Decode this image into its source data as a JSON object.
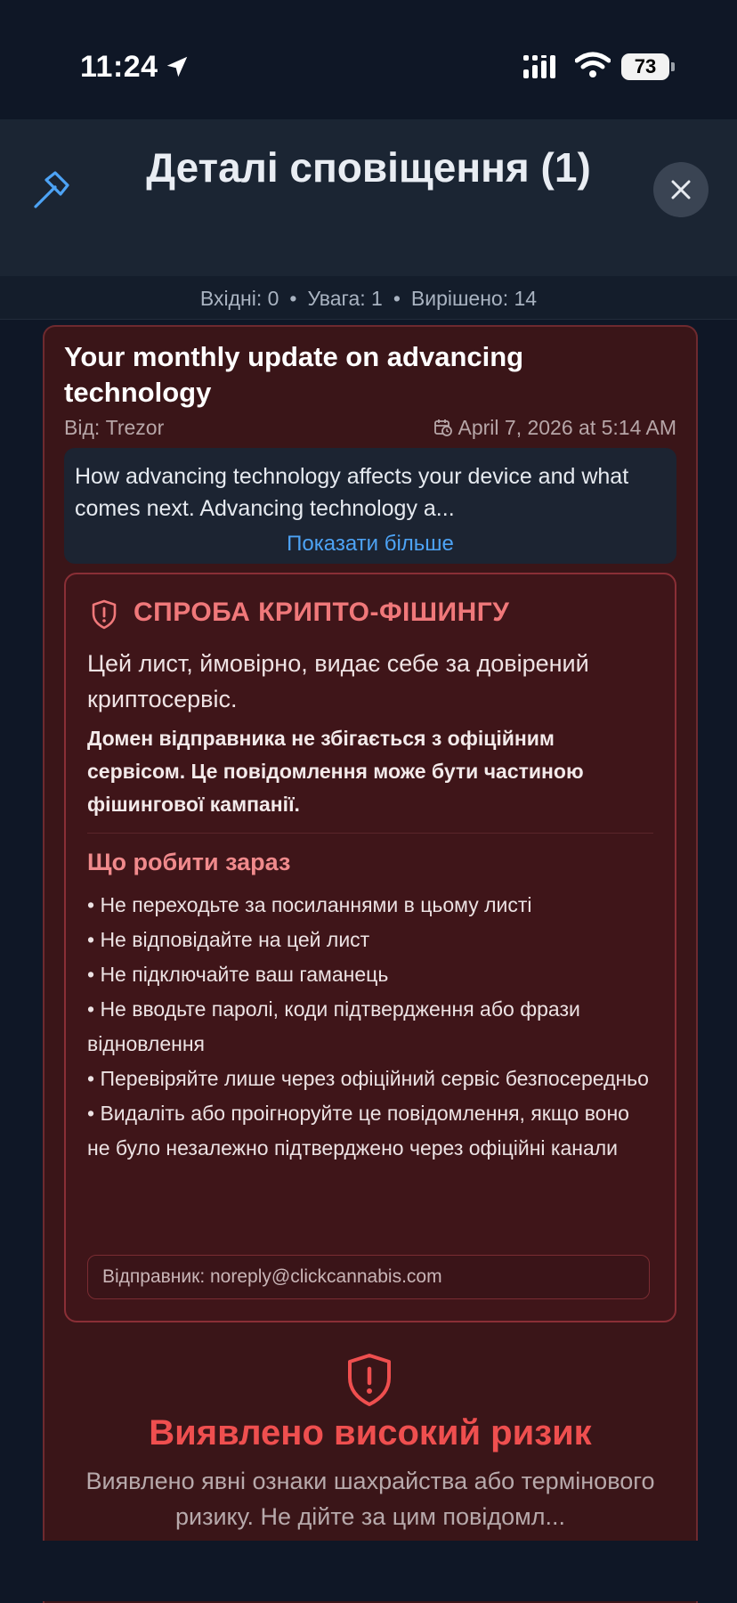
{
  "status_bar": {
    "time": "11:24",
    "battery": "73"
  },
  "header": {
    "title": "Деталі сповіщення (1)"
  },
  "stats": {
    "inbox": "Вхідні: 0",
    "attention": "Увага: 1",
    "resolved": "Вирішено: 14"
  },
  "email": {
    "title": "Your monthly update on advancing technology",
    "from": "Від: Trezor",
    "date": "April 7, 2026 at 5:14 AM",
    "preview": "How advancing technology affects your device and what comes next.  Advancing technology a...",
    "show_more": "Показати більше"
  },
  "alert": {
    "title": "СПРОБА КРИПТО-ФІШИНГУ",
    "lead": "Цей лист, ймовірно, видає себе за довірений криптосервіс.",
    "description": "Домен відправника не збігається з офіційним сервісом. Це повідомлення може бути частиною фішингової кампанії.",
    "todo_title": "Що робити зараз",
    "todo": [
      "• Не переходьте за посиланнями в цьому листі",
      "• Не відповідайте на цей лист",
      "• Не підключайте ваш гаманець",
      "• Не вводьте паролі, коди підтвердження або фрази відновлення",
      "• Перевіряйте лише через офіційний сервіс безпосередньо",
      "• Видаліть або проігноруйте це повідомлення, якщо воно не було незалежно підтверджено через офіційні канали"
    ],
    "sender": "Відправник: noreply@clickcannabis.com"
  },
  "risk": {
    "title": "Виявлено високий ризик",
    "description": "Виявлено явні ознаки шахрайства або термінового ризику. Не дійте за цим повідомл..."
  },
  "icons": {
    "location": "location-arrow-icon",
    "signal": "cellular-signal-icon",
    "wifi": "wifi-icon",
    "hammer": "hammer-icon",
    "close": "close-icon",
    "calendar": "calendar-clock-icon",
    "shield": "shield-alert-icon"
  },
  "colors": {
    "background": "#0f1726",
    "header": "#1b2533",
    "card": "#3a1518",
    "alert_red": "#f0787a",
    "risk_red": "#ef4f4f",
    "link_blue": "#4da3f5"
  }
}
